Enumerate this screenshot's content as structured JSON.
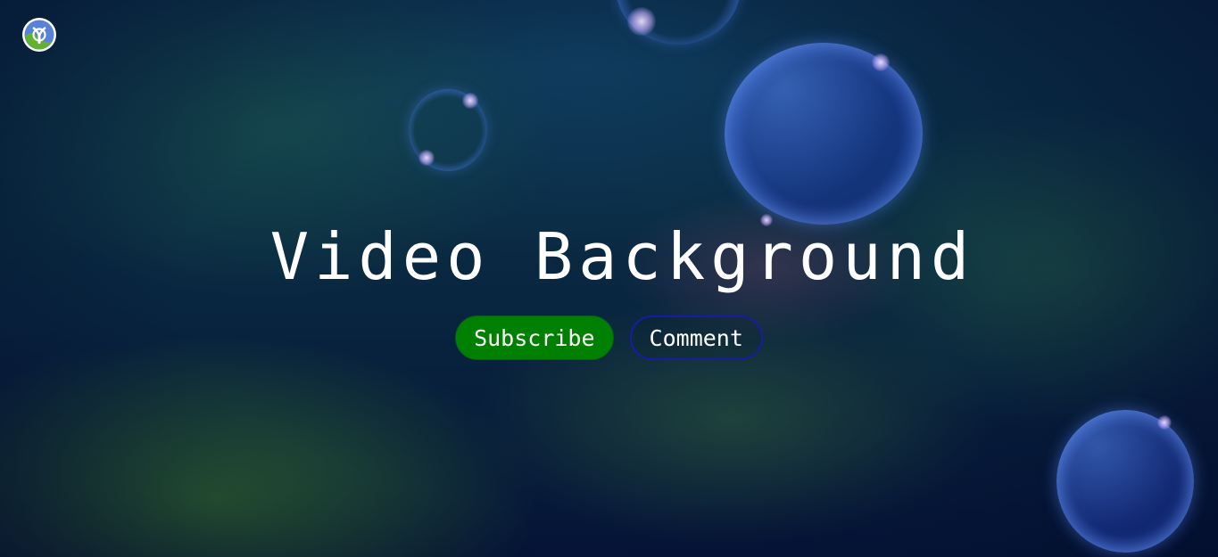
{
  "hero": {
    "title": "Video Background"
  },
  "actions": {
    "subscribe_label": "Subscribe",
    "comment_label": "Comment"
  },
  "colors": {
    "primary_button": "#008000",
    "secondary_button_border": "#1a1aa8",
    "text": "#ffffff"
  },
  "icons": {
    "logo": "clojure-logo-icon"
  }
}
